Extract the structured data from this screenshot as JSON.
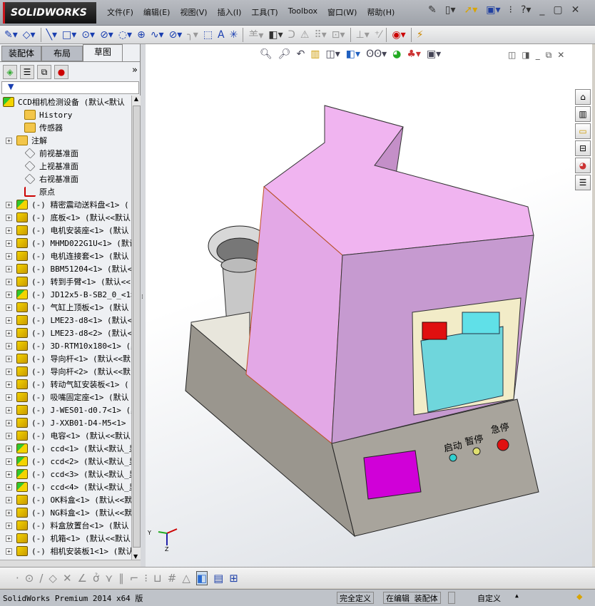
{
  "app": {
    "logo": "SOLIDWORKS"
  },
  "menu": [
    "文件(F)",
    "编辑(E)",
    "视图(V)",
    "插入(I)",
    "工具(T)",
    "Toolbox",
    "窗口(W)",
    "帮助(H)"
  ],
  "panel": {
    "tabs": [
      "装配体",
      "布局",
      "草图"
    ],
    "active_tab": "草图",
    "expand_label": "»",
    "filter_icon": "▼"
  },
  "tree": {
    "root": "CCD相机检测设备  (默认<默认",
    "items": [
      {
        "label": "History",
        "icon": "history-folder",
        "expand": false
      },
      {
        "label": "传感器",
        "icon": "sensor-folder",
        "expand": false
      },
      {
        "label": "注解",
        "icon": "annotation-folder",
        "expand": true
      },
      {
        "label": "前视基准面",
        "icon": "plane",
        "expand": false
      },
      {
        "label": "上视基准面",
        "icon": "plane",
        "expand": false
      },
      {
        "label": "右视基准面",
        "icon": "plane",
        "expand": false
      },
      {
        "label": "原点",
        "icon": "origin",
        "expand": false
      },
      {
        "label": "(-) 精密震动送料盘<1> (",
        "icon": "subassembly",
        "expand": true
      },
      {
        "label": "(-) 底板<1> (默认<<默认",
        "icon": "part",
        "expand": true
      },
      {
        "label": "(-) 电机安装座<1> (默认",
        "icon": "part",
        "expand": true
      },
      {
        "label": "(-) MHMD022G1U<1> (默认",
        "icon": "part",
        "expand": true
      },
      {
        "label": "(-) 电机连接套<1> (默认",
        "icon": "part",
        "expand": true
      },
      {
        "label": "(-) BBM51204<1> (默认<<",
        "icon": "part",
        "expand": true
      },
      {
        "label": "(-) 转到手臂<1> (默认<<",
        "icon": "part",
        "expand": true
      },
      {
        "label": "(-) JD12x5-B-SB2_0_<1>",
        "icon": "subassembly",
        "expand": true
      },
      {
        "label": "(-) 气缸上顶板<1> (默认",
        "icon": "part",
        "expand": true
      },
      {
        "label": "(-) LME23-d8<1> (默认<<",
        "icon": "part",
        "expand": true
      },
      {
        "label": "(-) LME23-d8<2> (默认<<",
        "icon": "part",
        "expand": true
      },
      {
        "label": "(-) 3D-RTM10x180<1> (默",
        "icon": "part",
        "expand": true
      },
      {
        "label": "(-) 导向杆<1> (默认<<默",
        "icon": "part",
        "expand": true
      },
      {
        "label": "(-) 导向杆<2> (默认<<默",
        "icon": "part",
        "expand": true
      },
      {
        "label": "(-) 转动气缸安装板<1> (",
        "icon": "part",
        "expand": true
      },
      {
        "label": "(-) 吸嘴固定座<1> (默认",
        "icon": "part",
        "expand": true
      },
      {
        "label": "(-) J-WES01-d0.7<1> (默",
        "icon": "part",
        "expand": true
      },
      {
        "label": "(-) J-XXB01-D4-M5<1> (默",
        "icon": "part",
        "expand": true
      },
      {
        "label": "(-) 电容<1> (默认<<默认",
        "icon": "part",
        "expand": true
      },
      {
        "label": "(-) ccd<1> (默认<默认_显",
        "icon": "subassembly",
        "expand": true
      },
      {
        "label": "(-) ccd<2> (默认<默认_显",
        "icon": "subassembly",
        "expand": true
      },
      {
        "label": "(-) ccd<3> (默认<默认_显",
        "icon": "subassembly",
        "expand": true
      },
      {
        "label": "(-) ccd<4> (默认<默认_显",
        "icon": "subassembly",
        "expand": true
      },
      {
        "label": "(-) OK料盒<1> (默认<<默",
        "icon": "part",
        "expand": true
      },
      {
        "label": "(-) NG料盒<1> (默认<<默",
        "icon": "part",
        "expand": true
      },
      {
        "label": "(-) 料盒放置台<1> (默认",
        "icon": "part",
        "expand": true
      },
      {
        "label": "(-) 机箱<1> (默认<<默认",
        "icon": "part",
        "expand": true
      },
      {
        "label": "(-) 相机安装板1<1> (默认",
        "icon": "part",
        "expand": true
      }
    ]
  },
  "model": {
    "panel_labels": [
      "启动",
      "暂停",
      "急停"
    ],
    "colors": {
      "housing": "#f0b4f0",
      "base": "#a8a49c",
      "screen": "#d000d8",
      "box": "#6fd6dc",
      "start": "#30d0d0",
      "pause": "#e0e070",
      "estop": "#e01010"
    }
  },
  "status": {
    "product": "SolidWorks Premium 2014 x64 版",
    "definition": "完全定义",
    "mode": "在编辑 装配体",
    "units": "自定义",
    "units_arrow": "▲"
  }
}
